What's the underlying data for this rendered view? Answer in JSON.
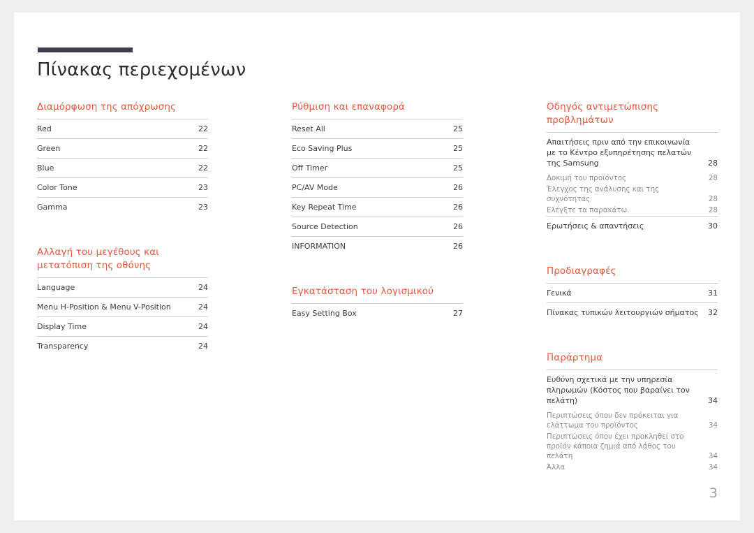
{
  "document": {
    "title": "Πίνακας περιεχομένων",
    "page_number": "3",
    "accent_color": "#e3593b",
    "rule_color": "#413d4b"
  },
  "columns": [
    {
      "sections": [
        {
          "heading": "Διαμόρφωση της απόχρωσης",
          "entries": [
            {
              "label": "Red",
              "page": "22",
              "level": "main"
            },
            {
              "label": "Green",
              "page": "22",
              "level": "main"
            },
            {
              "label": "Blue",
              "page": "22",
              "level": "main"
            },
            {
              "label": "Color Tone",
              "page": "23",
              "level": "main"
            },
            {
              "label": "Gamma",
              "page": "23",
              "level": "main"
            }
          ]
        },
        {
          "heading": "Αλλαγή του μεγέθους και μετατόπιση της οθόνης",
          "entries": [
            {
              "label": "Language",
              "page": "24",
              "level": "main"
            },
            {
              "label": "Menu H-Position & Menu V-Position",
              "page": "24",
              "level": "main"
            },
            {
              "label": "Display Time",
              "page": "24",
              "level": "main"
            },
            {
              "label": "Transparency",
              "page": "24",
              "level": "main"
            }
          ]
        }
      ]
    },
    {
      "sections": [
        {
          "heading": "Ρύθμιση και επαναφορά",
          "entries": [
            {
              "label": "Reset All",
              "page": "25",
              "level": "main"
            },
            {
              "label": "Eco Saving Plus",
              "page": "25",
              "level": "main"
            },
            {
              "label": "Off Timer",
              "page": "25",
              "level": "main"
            },
            {
              "label": "PC/AV Mode",
              "page": "26",
              "level": "main"
            },
            {
              "label": "Key Repeat Time",
              "page": "26",
              "level": "main"
            },
            {
              "label": "Source Detection",
              "page": "26",
              "level": "main"
            },
            {
              "label": "INFORMATION",
              "page": "26",
              "level": "main"
            }
          ]
        },
        {
          "heading": "Εγκατάσταση του λογισμικού",
          "entries": [
            {
              "label": "Easy Setting Box",
              "page": "27",
              "level": "main"
            }
          ]
        }
      ]
    },
    {
      "sections": [
        {
          "heading": "Οδηγός αντιμετώπισης προβλημάτων",
          "entries": [
            {
              "label": "Απαιτήσεις πριν από την επικοινωνία με το Κέντρο εξυπηρέτησης πελατών της Samsung",
              "page": "28",
              "level": "main"
            },
            {
              "label": "Δοκιμή του προϊόντος",
              "page": "28",
              "level": "sub"
            },
            {
              "label": "Έλεγχος της ανάλυσης και της συχνότητας",
              "page": "28",
              "level": "sub"
            },
            {
              "label": "Ελέγξτε τα παρακάτω.",
              "page": "28",
              "level": "sub"
            },
            {
              "label": "Ερωτήσεις & απαντήσεις",
              "page": "30",
              "level": "main"
            }
          ]
        },
        {
          "heading": "Προδιαγραφές",
          "entries": [
            {
              "label": "Γενικά",
              "page": "31",
              "level": "main"
            },
            {
              "label": "Πίνακας τυπικών λειτουργιών σήματος",
              "page": "32",
              "level": "main"
            }
          ]
        },
        {
          "heading": "Παράρτημα",
          "entries": [
            {
              "label": "Ευθύνη σχετικά με την υπηρεσία πληρωμών (Κόστος που βαραίνει τον πελάτη)",
              "page": "34",
              "level": "main"
            },
            {
              "label": "Περιπτώσεις όπου δεν πρόκειται για ελάττωμα του προϊόντος",
              "page": "34",
              "level": "sub"
            },
            {
              "label": "Περιπτώσεις όπου έχει προκληθεί στο προϊόν κάποια ζημιά από λάθος του πελάτη",
              "page": "34",
              "level": "sub"
            },
            {
              "label": "Άλλα",
              "page": "34",
              "level": "sub"
            }
          ]
        }
      ]
    }
  ]
}
